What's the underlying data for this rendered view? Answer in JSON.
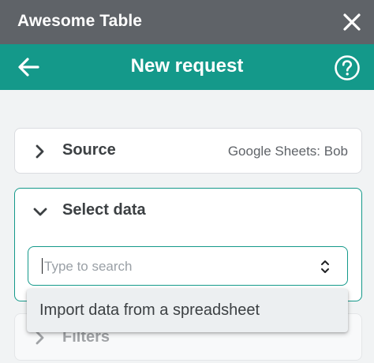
{
  "window": {
    "title": "Awesome Table"
  },
  "header": {
    "title": "New request"
  },
  "source": {
    "label": "Source",
    "value": "Google Sheets: Bob"
  },
  "select_data": {
    "label": "Select data",
    "search_placeholder": "Type to search",
    "search_value": ""
  },
  "dropdown": {
    "options": [
      "Import data from a spreadsheet"
    ]
  },
  "filters": {
    "label": "Filters"
  },
  "icons": {
    "close": "close-icon",
    "back": "arrow-back-icon",
    "help": "help-circle-icon",
    "expand": "chevron-right-icon",
    "collapse": "chevron-down-icon",
    "select": "up-down-arrows-icon"
  },
  "colors": {
    "titlebar": "#5f6368",
    "accent": "#14998a",
    "background": "#f1f3f4"
  }
}
